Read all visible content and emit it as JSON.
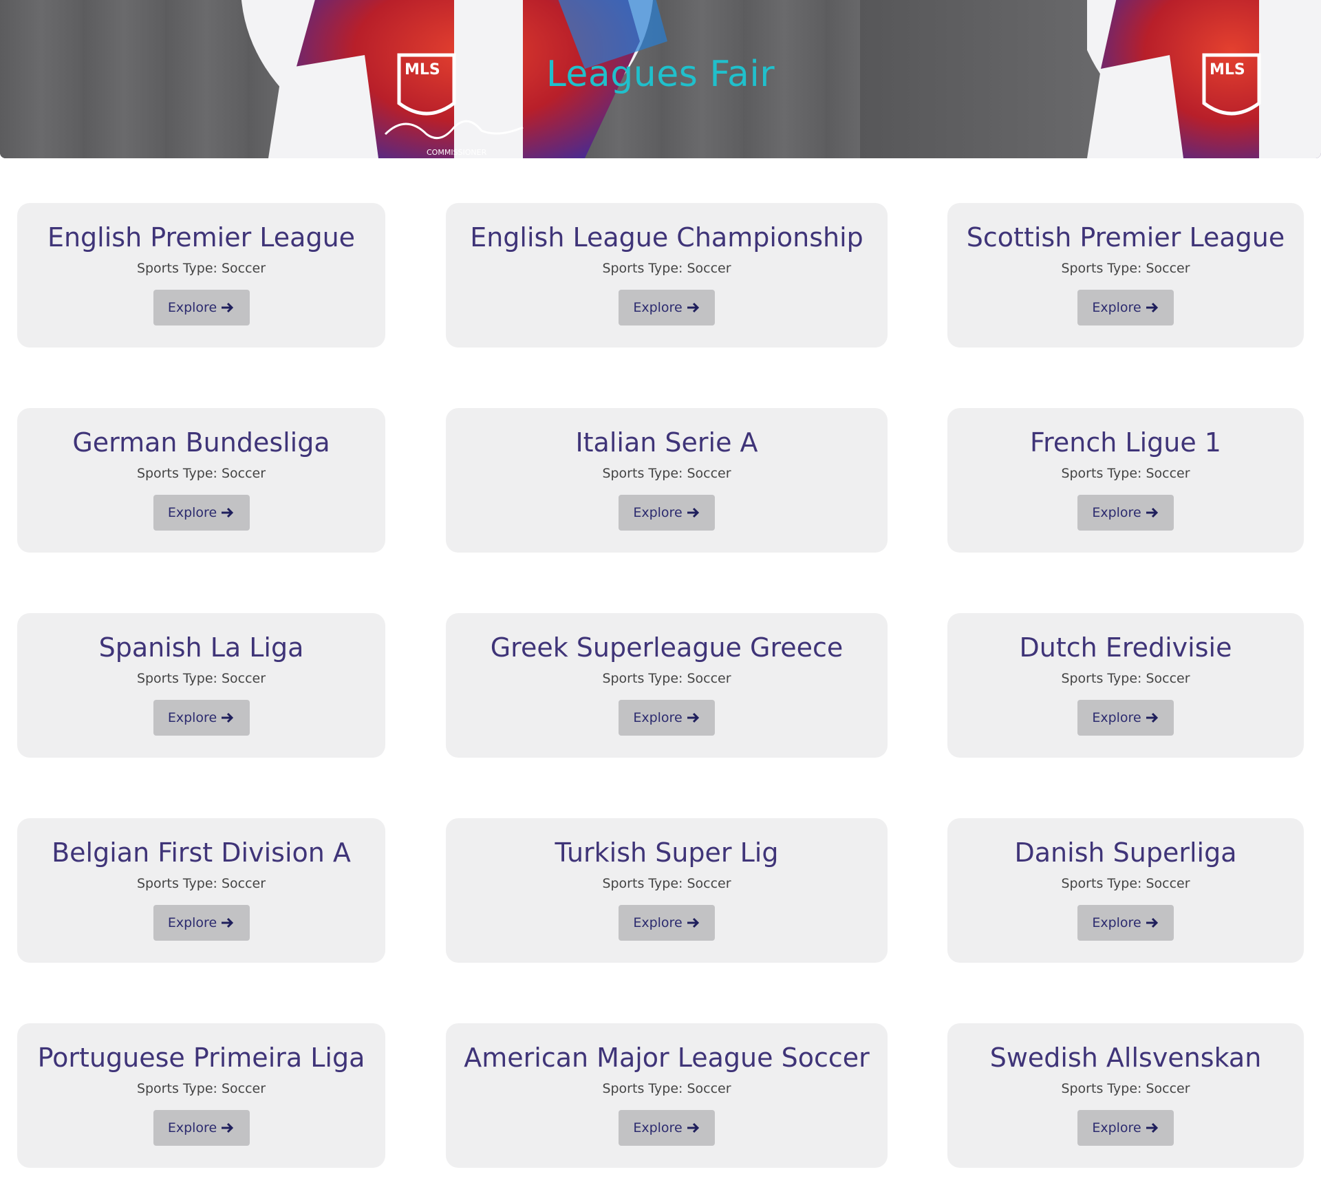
{
  "header": {
    "title": "Leagues Fair",
    "title_color": "#20c0cc",
    "ball_logo_text": "MLS",
    "ball_caption": "COMMISSIONER"
  },
  "card_style": {
    "background": "#efeff0",
    "title_color": "#3f3478",
    "button_bg": "#c2c2c4",
    "button_text_color": "#2b2a6e"
  },
  "leagues": [
    {
      "name": "English Premier League",
      "sport": "Sports Type: Soccer",
      "button": "Explore",
      "icon": "arrow-right-icon"
    },
    {
      "name": "English League Championship",
      "sport": "Sports Type: Soccer",
      "button": "Explore",
      "icon": "arrow-right-icon"
    },
    {
      "name": "Scottish Premier League",
      "sport": "Sports Type: Soccer",
      "button": "Explore",
      "icon": "arrow-right-icon"
    },
    {
      "name": "German Bundesliga",
      "sport": "Sports Type: Soccer",
      "button": "Explore",
      "icon": "arrow-right-icon"
    },
    {
      "name": "Italian Serie A",
      "sport": "Sports Type: Soccer",
      "button": "Explore",
      "icon": "arrow-right-icon"
    },
    {
      "name": "French Ligue 1",
      "sport": "Sports Type: Soccer",
      "button": "Explore",
      "icon": "arrow-right-icon"
    },
    {
      "name": "Spanish La Liga",
      "sport": "Sports Type: Soccer",
      "button": "Explore",
      "icon": "arrow-right-icon"
    },
    {
      "name": "Greek Superleague Greece",
      "sport": "Sports Type: Soccer",
      "button": "Explore",
      "icon": "arrow-right-icon"
    },
    {
      "name": "Dutch Eredivisie",
      "sport": "Sports Type: Soccer",
      "button": "Explore",
      "icon": "arrow-right-icon"
    },
    {
      "name": "Belgian First Division A",
      "sport": "Sports Type: Soccer",
      "button": "Explore",
      "icon": "arrow-right-icon"
    },
    {
      "name": "Turkish Super Lig",
      "sport": "Sports Type: Soccer",
      "button": "Explore",
      "icon": "arrow-right-icon"
    },
    {
      "name": "Danish Superliga",
      "sport": "Sports Type: Soccer",
      "button": "Explore",
      "icon": "arrow-right-icon"
    },
    {
      "name": "Portuguese Primeira Liga",
      "sport": "Sports Type: Soccer",
      "button": "Explore",
      "icon": "arrow-right-icon"
    },
    {
      "name": "American Major League Soccer",
      "sport": "Sports Type: Soccer",
      "button": "Explore",
      "icon": "arrow-right-icon"
    },
    {
      "name": "Swedish Allsvenskan",
      "sport": "Sports Type: Soccer",
      "button": "Explore",
      "icon": "arrow-right-icon"
    }
  ]
}
